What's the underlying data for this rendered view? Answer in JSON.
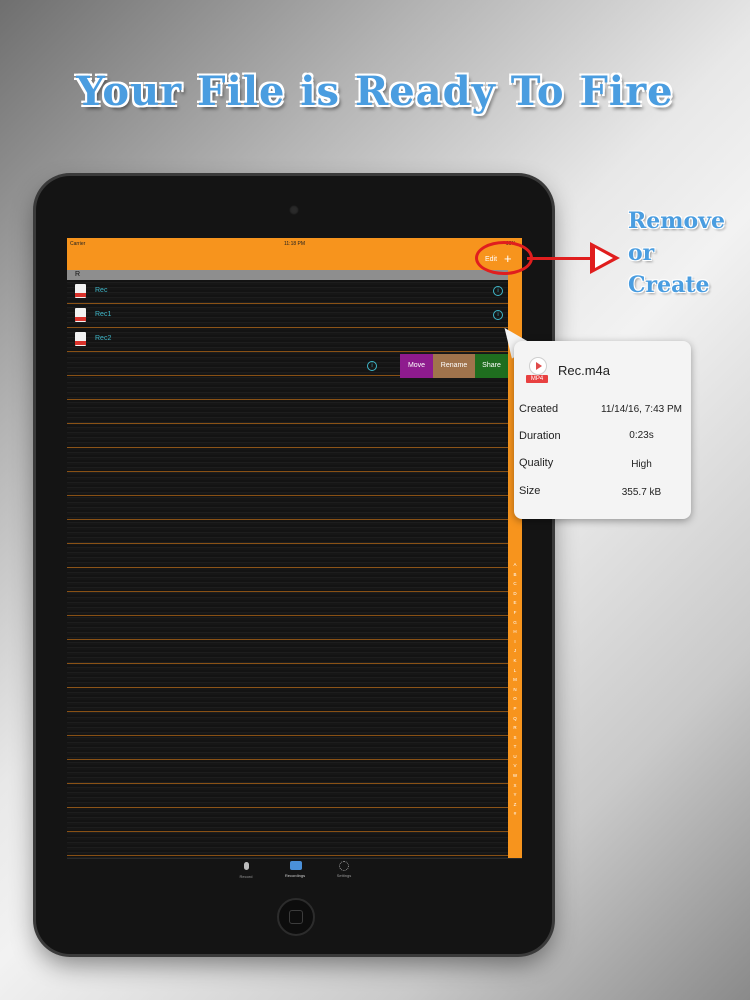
{
  "headline": "Your File is Ready To Fire",
  "side_note": [
    "Remove",
    "or",
    "Create"
  ],
  "colors": {
    "accent": "#f7941d",
    "link": "#3fb7c9",
    "annotation": "#e01e1e",
    "headline": "#4a9de0"
  },
  "status_bar": {
    "carrier": "Carrier",
    "time": "11:18 PM",
    "battery": "99%"
  },
  "nav": {
    "edit_label": "Edit",
    "add_label": "+"
  },
  "section": {
    "title": "R"
  },
  "files": [
    {
      "name": "Rec"
    },
    {
      "name": "Rec1"
    },
    {
      "name": "Rec2"
    }
  ],
  "swipe_actions": {
    "move": "Move",
    "rename": "Rename",
    "share": "Share"
  },
  "index_letters": "A B C D E F G H I J K L M N O P Q R S T U V W X Y Z #",
  "tabs": [
    {
      "label": "Record",
      "icon": "mic-icon"
    },
    {
      "label": "Recordings",
      "icon": "recordings-icon"
    },
    {
      "label": "Settings",
      "icon": "gear-icon"
    }
  ],
  "popover": {
    "file_name": "Rec.m4a",
    "file_type": "MP4",
    "details": [
      {
        "label": "Created",
        "value": "11/14/16, 7:43 PM"
      },
      {
        "label": "Duration",
        "value": "0:23s"
      },
      {
        "label": "Quality",
        "value": "High"
      },
      {
        "label": "Size",
        "value": "355.7 kB"
      }
    ]
  }
}
